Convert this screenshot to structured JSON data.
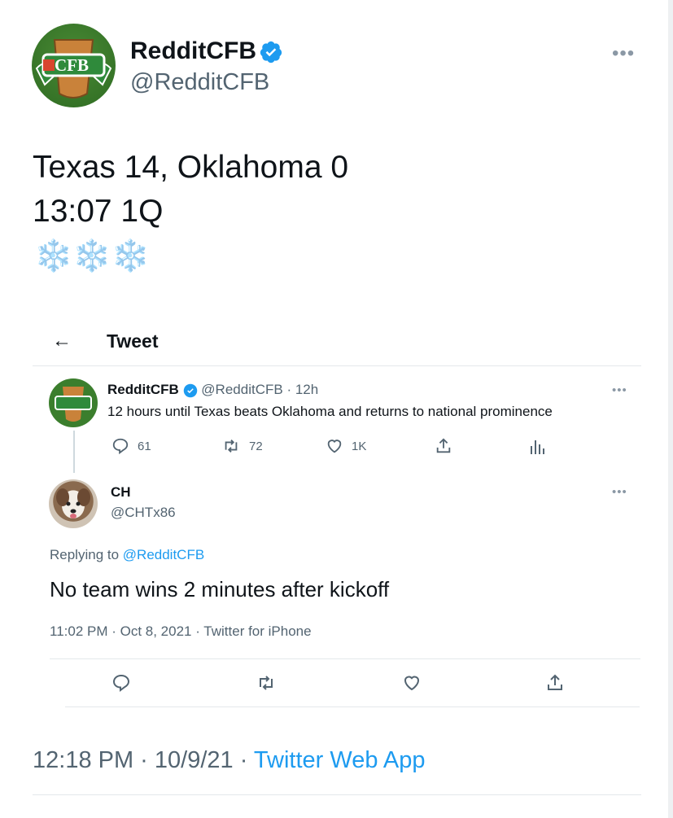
{
  "main_tweet": {
    "display_name": "RedditCFB",
    "handle": "@RedditCFB",
    "line1": "Texas 14, Oklahoma 0",
    "line2": "13:07 1Q",
    "emoji": "❄️❄️❄️",
    "timestamp": "12:18 PM · 10/9/21 · ",
    "source": "Twitter Web App",
    "avatar_text": "CFB"
  },
  "quoted_screenshot": {
    "header_title": "Tweet",
    "parent": {
      "display_name": "RedditCFB",
      "handle": "@RedditCFB",
      "time": "· 12h",
      "text": "12 hours until Texas beats Oklahoma and returns to national prominence",
      "reply_count": "61",
      "retweet_count": "72",
      "like_count": "1K"
    },
    "reply": {
      "display_name": "CH",
      "handle": "@CHTx86",
      "replying_label": "Replying to ",
      "replying_handle": "@RedditCFB",
      "text": "No team wins 2 minutes after kickoff",
      "meta": "11:02 PM · Oct 8, 2021 · Twitter for iPhone"
    }
  },
  "colors": {
    "accent": "#1d9bf0",
    "verified": "#1d9bf0",
    "text": "#0f1419",
    "muted": "#536471"
  }
}
